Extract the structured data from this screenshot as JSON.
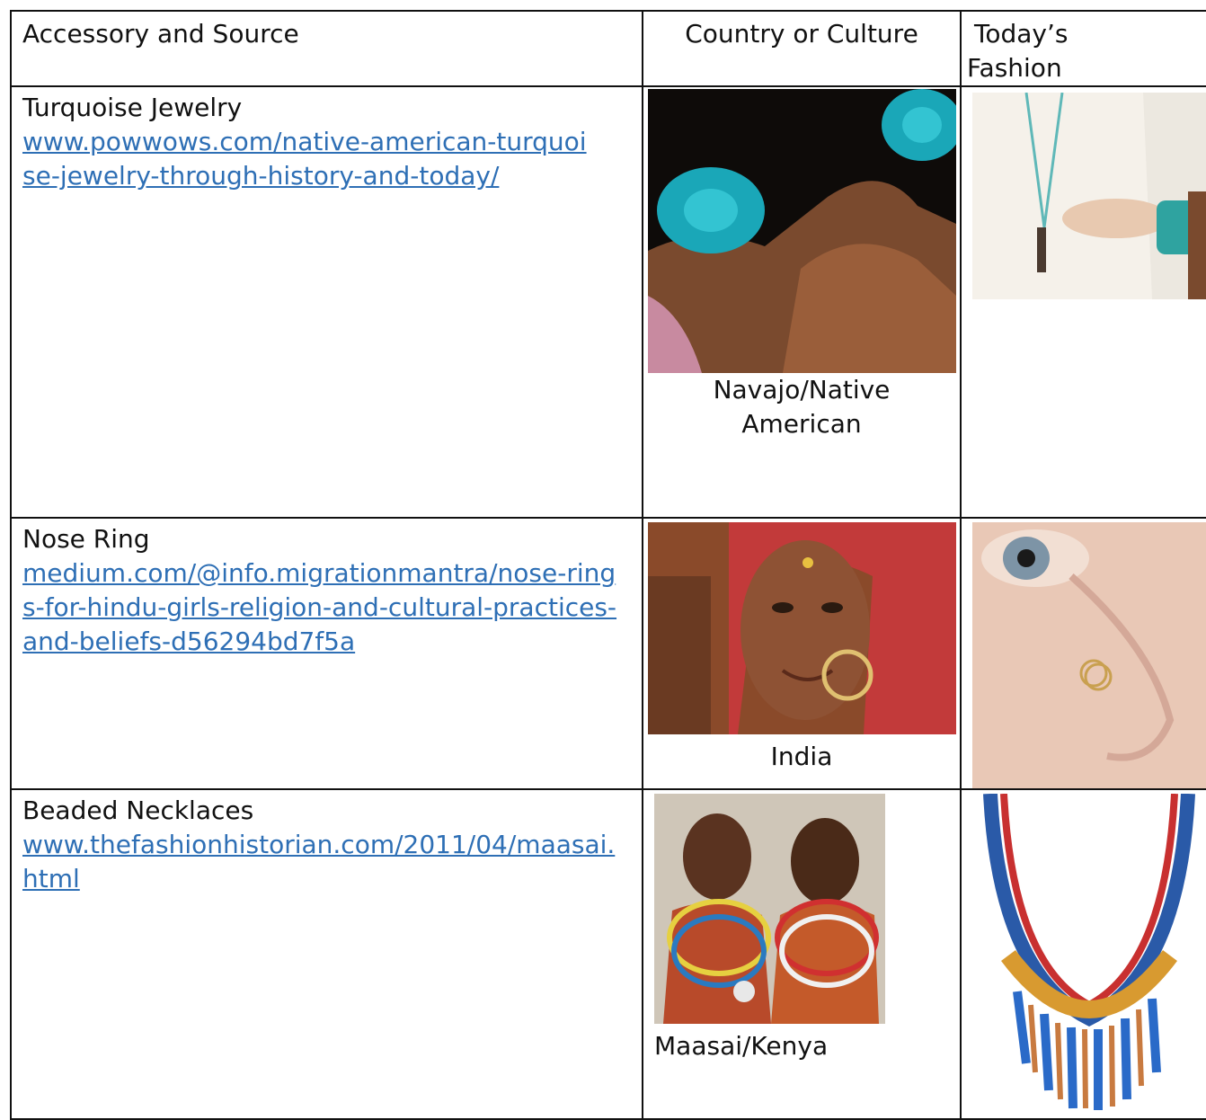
{
  "headers": {
    "accessory": "Accessory and Source",
    "country": "Country or Culture",
    "fashion_line1": "Today’s",
    "fashion_line2": "Fashion"
  },
  "rows": [
    {
      "title": "Turquoise Jewelry",
      "link": "www.powwows.com/native-american-turquoise-jewelry-through-history-and-today/",
      "culture": "Navajo/Native American",
      "culture_line1": "Navajo/Native",
      "culture_line2": "American"
    },
    {
      "title": "Nose Ring",
      "link": "medium.com/@info.migrationmantra/nose-rings-for-hindu-girls-religion-and-cultural-practices-and-beliefs-d56294bd7f5a",
      "culture": "India"
    },
    {
      "title": "Beaded Necklaces",
      "link": "www.thefashionhistorian.com/2011/04/maasai.html",
      "culture": "Maasai/Kenya"
    }
  ],
  "colors": {
    "link": "#2e6fb5",
    "border": "#111111",
    "turquoise": "#1aa7b8"
  }
}
